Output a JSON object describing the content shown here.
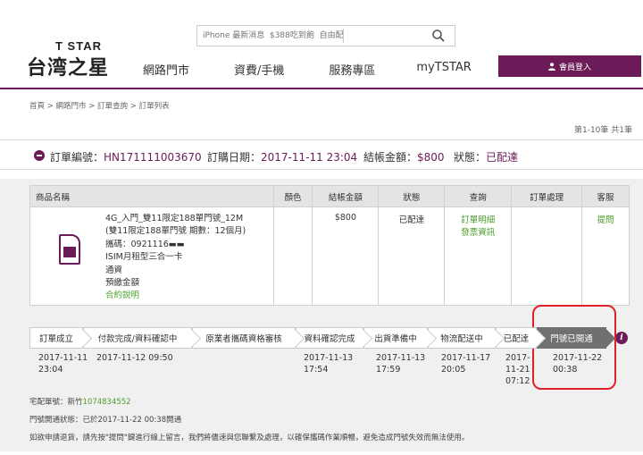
{
  "header": {
    "brand_small": "T STAR",
    "brand_big": "台湾之星",
    "search_placeholder": "iPhone 最新消息  $388吃到飽  自由配",
    "nav": [
      "網路門市",
      "資費/手機",
      "服務專區",
      "myTSTAR"
    ],
    "login_label": "會員登入"
  },
  "breadcrumb": "首頁 > 網路門市 > 訂單查詢 > 訂單列表",
  "pagination_info": "第1-10筆 共1筆",
  "order": {
    "number_label": "訂單編號：",
    "number": "HN171111003670",
    "date_label": "訂購日期：",
    "date": "2017-11-11 23:04",
    "amount_label": "結帳金額：",
    "amount": "$800",
    "status_label": "狀態：",
    "status": "已配達"
  },
  "table": {
    "headers": [
      "商品名稱",
      "顏色",
      "結帳金額",
      "狀態",
      "查詢",
      "訂單處理",
      "客服"
    ],
    "row": {
      "product_lines": [
        "4G_入門_雙11限定188單門號_12M",
        "(雙11限定188單門號 期數：12個月)",
        "攜碼：0921116▬▬",
        "ISIM月租型三合一卡",
        "通資",
        "預繳金額"
      ],
      "contract_link": "合約說明",
      "color": "",
      "amount": "$800",
      "status": "已配達",
      "query_links": [
        "訂單明細",
        "發票資訊"
      ],
      "processing": "",
      "support_link": "提問"
    }
  },
  "timeline": {
    "steps": [
      "訂單成立",
      "付款完成/資料確認中",
      "原業者攜碼資格審核",
      "資料確認完成",
      "出貨準備中",
      "物流配送中",
      "已配達",
      "門號已開通"
    ],
    "dates": [
      [
        "2017-11-11",
        "23:04"
      ],
      [
        "2017-11-12 09:50"
      ],
      [
        ""
      ],
      [
        "2017-11-13",
        "17:54"
      ],
      [
        "2017-11-13",
        "17:59"
      ],
      [
        "2017-11-17",
        "20:05"
      ],
      [
        "2017-",
        "11-21",
        "07:12"
      ],
      [
        "2017-11-22",
        "00:38"
      ]
    ],
    "info_icon": "i"
  },
  "notes": {
    "tracking_label": "宅配單號：新竹",
    "tracking_number": "1074834552",
    "activation": "門號開通狀態：已於2017-11-22 00:38開通",
    "disclaimer": "如欲申請退貨，請先按\"提問\"鍵進行線上留言，我們將儘速與您聯繫及處理，以確保攜碼作業順暢，避免造成門號失效而無法使用。"
  },
  "colors": {
    "brand_purple": "#6a1b58",
    "link_green": "#4a9e2a",
    "highlight_red": "#e0202a"
  }
}
